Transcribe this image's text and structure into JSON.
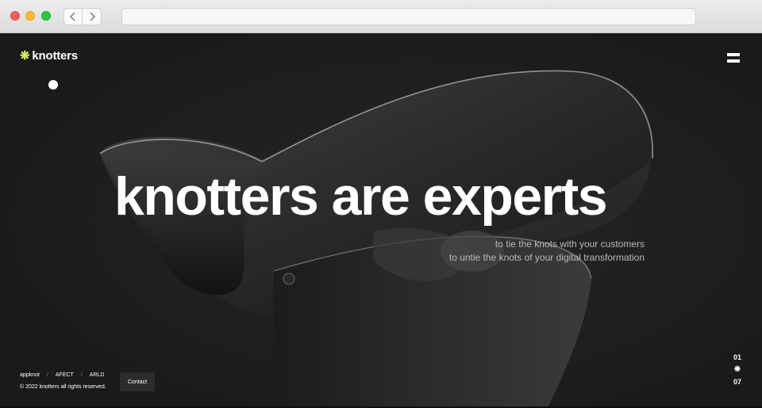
{
  "browser": {
    "url": ""
  },
  "brand": {
    "logo_mark": "❋",
    "name": "knotters",
    "accent": "#d6f25c"
  },
  "hero": {
    "title": "knotters are experts",
    "subtitle_line1": "to tie the knots with your customers",
    "subtitle_line2": "to untie the knots of your digital transformation"
  },
  "footer": {
    "partners": [
      "appknot",
      "AFECT",
      "ARLD"
    ],
    "separator": "/",
    "copyright": "© 2022 knotters all rights reserved.",
    "contact_label": "Contact"
  },
  "pager": {
    "current": "01",
    "divider": "❋",
    "total": "07"
  },
  "colors": {
    "page_background": "#1b1b1b",
    "text": "#ffffff",
    "subtitle": "#b9b9b9"
  }
}
